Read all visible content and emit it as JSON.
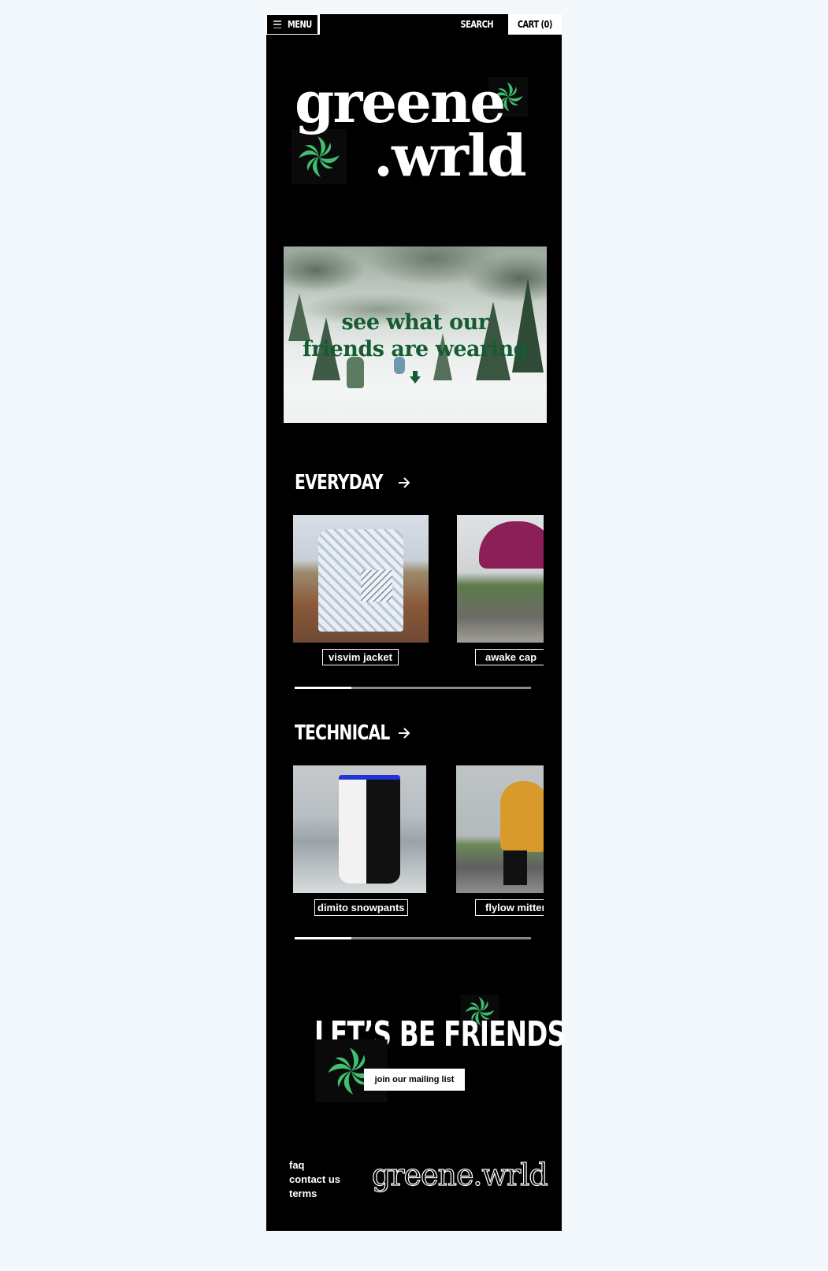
{
  "nav": {
    "menu_label": "MENU",
    "search_label": "SEARCH",
    "cart_label": "CART (0)"
  },
  "brand": {
    "logo_line1": "greene",
    "logo_line2": ".wrld",
    "accent_color": "#3fbf6f"
  },
  "hero": {
    "line1": "see what our",
    "line2": "friends are wearing",
    "text_color": "#155c34"
  },
  "sections": [
    {
      "title": "EVERYDAY",
      "products": [
        {
          "name": "visvim jacket"
        },
        {
          "name": "awake cap"
        }
      ]
    },
    {
      "title": "TECHNICAL",
      "products": [
        {
          "name": "dimito snowpants"
        },
        {
          "name": "flylow mittens"
        }
      ]
    }
  ],
  "friends": {
    "title": "LET’S BE FRIENDS",
    "button_label": "join our mailing list"
  },
  "footer": {
    "links": [
      "faq",
      "contact us",
      "terms"
    ],
    "logo": "greene.wrld"
  }
}
